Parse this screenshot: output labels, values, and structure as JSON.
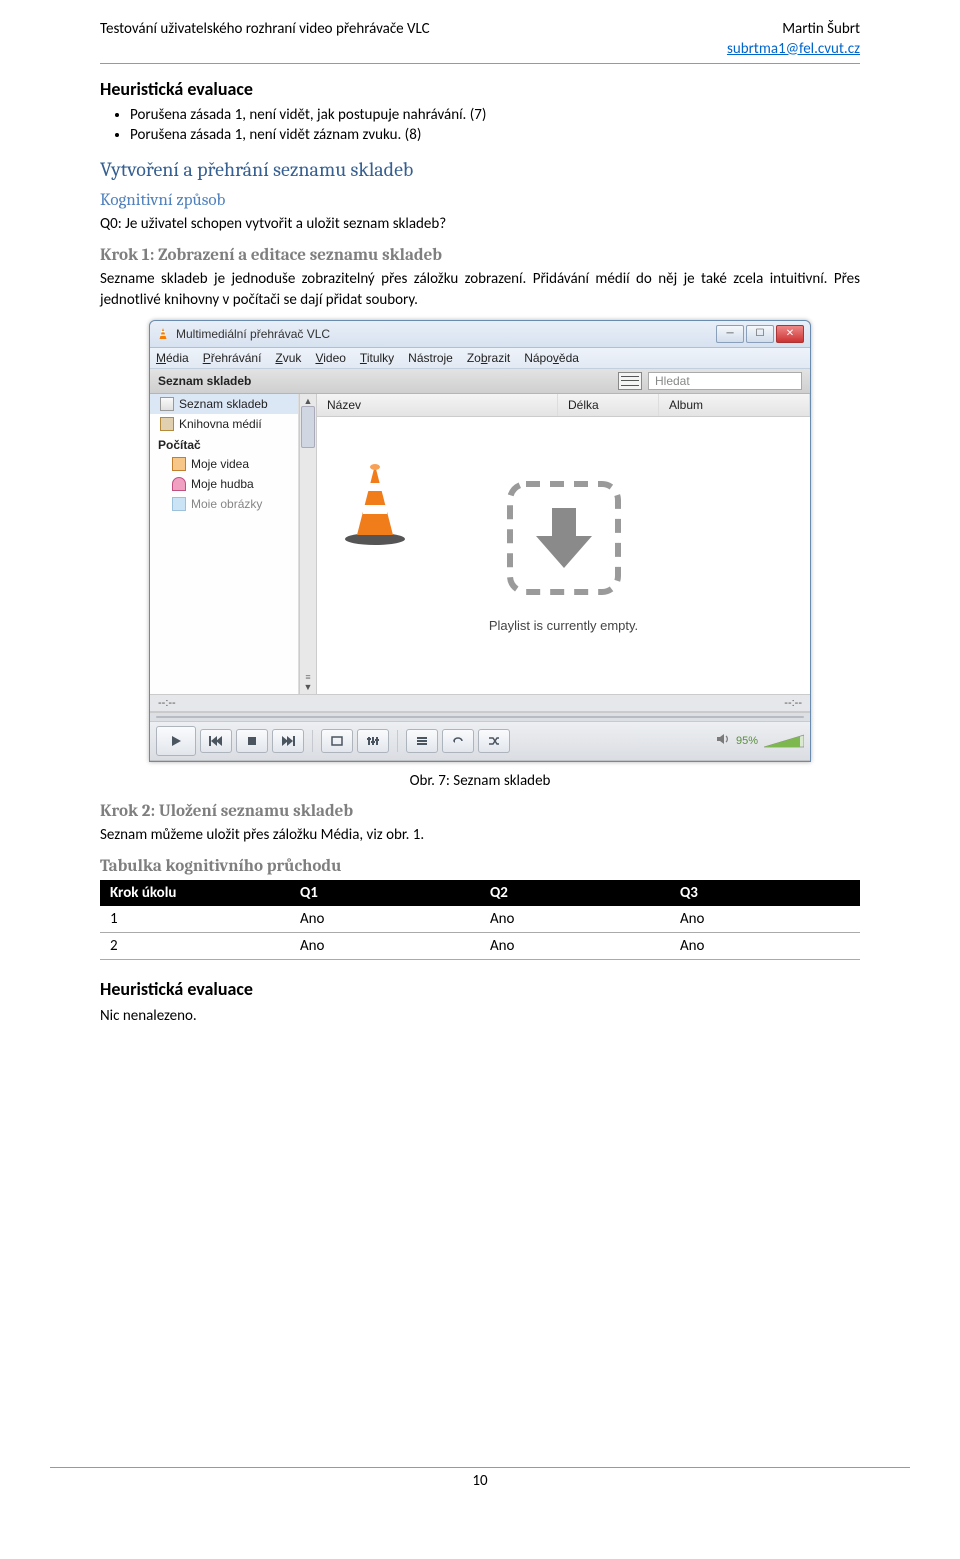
{
  "doc": {
    "header_title": "Testování uživatelského rozhraní video přehrávače VLC",
    "author": "Martin Šubrt",
    "email": "subrtma1@fel.cvut.cz"
  },
  "sec": {
    "heur_eval": "Heuristická evaluace",
    "bullet1": "Porušena zásada 1, není vidět, jak postupuje nahrávání. (7)",
    "bullet2": "Porušena zásada 1, není vidět záznam zvuku. (8)",
    "task_title": "Vytvoření a přehrání seznamu skladeb",
    "cog_method": "Kognitivní způsob",
    "q0": "Q0: Je uživatel schopen vytvořit a uložit seznam skladeb?",
    "step1_title": "Krok 1: Zobrazení a editace seznamu skladeb",
    "step1_text": "Sezname skladeb je jednoduše zobrazitelný přes záložku zobrazení. Přidávání médií do něj je také zcela intuitivní. Přes jednotlivé knihovny v počítači se dají přidat soubory.",
    "fig_caption": "Obr. 7: Seznam skladeb",
    "step2_title": "Krok 2: Uložení seznamu skladeb",
    "step2_text": "Seznam můžeme uložit přes záložku Média, viz obr. 1.",
    "cog_table_title": "Tabulka kognitivního průchodu",
    "heur_eval2": "Heuristická evaluace",
    "heur_result": "Nic nenalezeno."
  },
  "table": {
    "h1": "Krok úkolu",
    "h2": "Q1",
    "h3": "Q2",
    "h4": "Q3",
    "r1c1": "1",
    "r2c1": "2",
    "ano": "Ano"
  },
  "vlc": {
    "title": "Multimediální přehrávač VLC",
    "menu": {
      "media": "Média",
      "media_u": "M",
      "play": "Přehrávání",
      "play_u": "P",
      "sound": "Zvuk",
      "sound_u": "Z",
      "video": "Video",
      "video_u": "V",
      "subs": "Titulky",
      "subs_u": "T",
      "tools": "Nástroje",
      "tools_u": "N",
      "view": "Zobrazit",
      "view_u": "b",
      "help": "Nápověda",
      "help_u": "v"
    },
    "playlist": {
      "header": "Seznam skladeb",
      "search_placeholder": "Hledat",
      "col_name": "Název",
      "col_len": "Délka",
      "col_album": "Album",
      "empty": "Playlist is currently empty."
    },
    "sidebar": {
      "playlist": "Seznam skladeb",
      "library": "Knihovna médií",
      "computer": "Počítač",
      "videos": "Moje videa",
      "music": "Moje hudba",
      "pics": "Moie obrázky"
    },
    "time_left": "--:--",
    "time_right": "--:--",
    "vol_label": "95%"
  },
  "page_number": "10"
}
